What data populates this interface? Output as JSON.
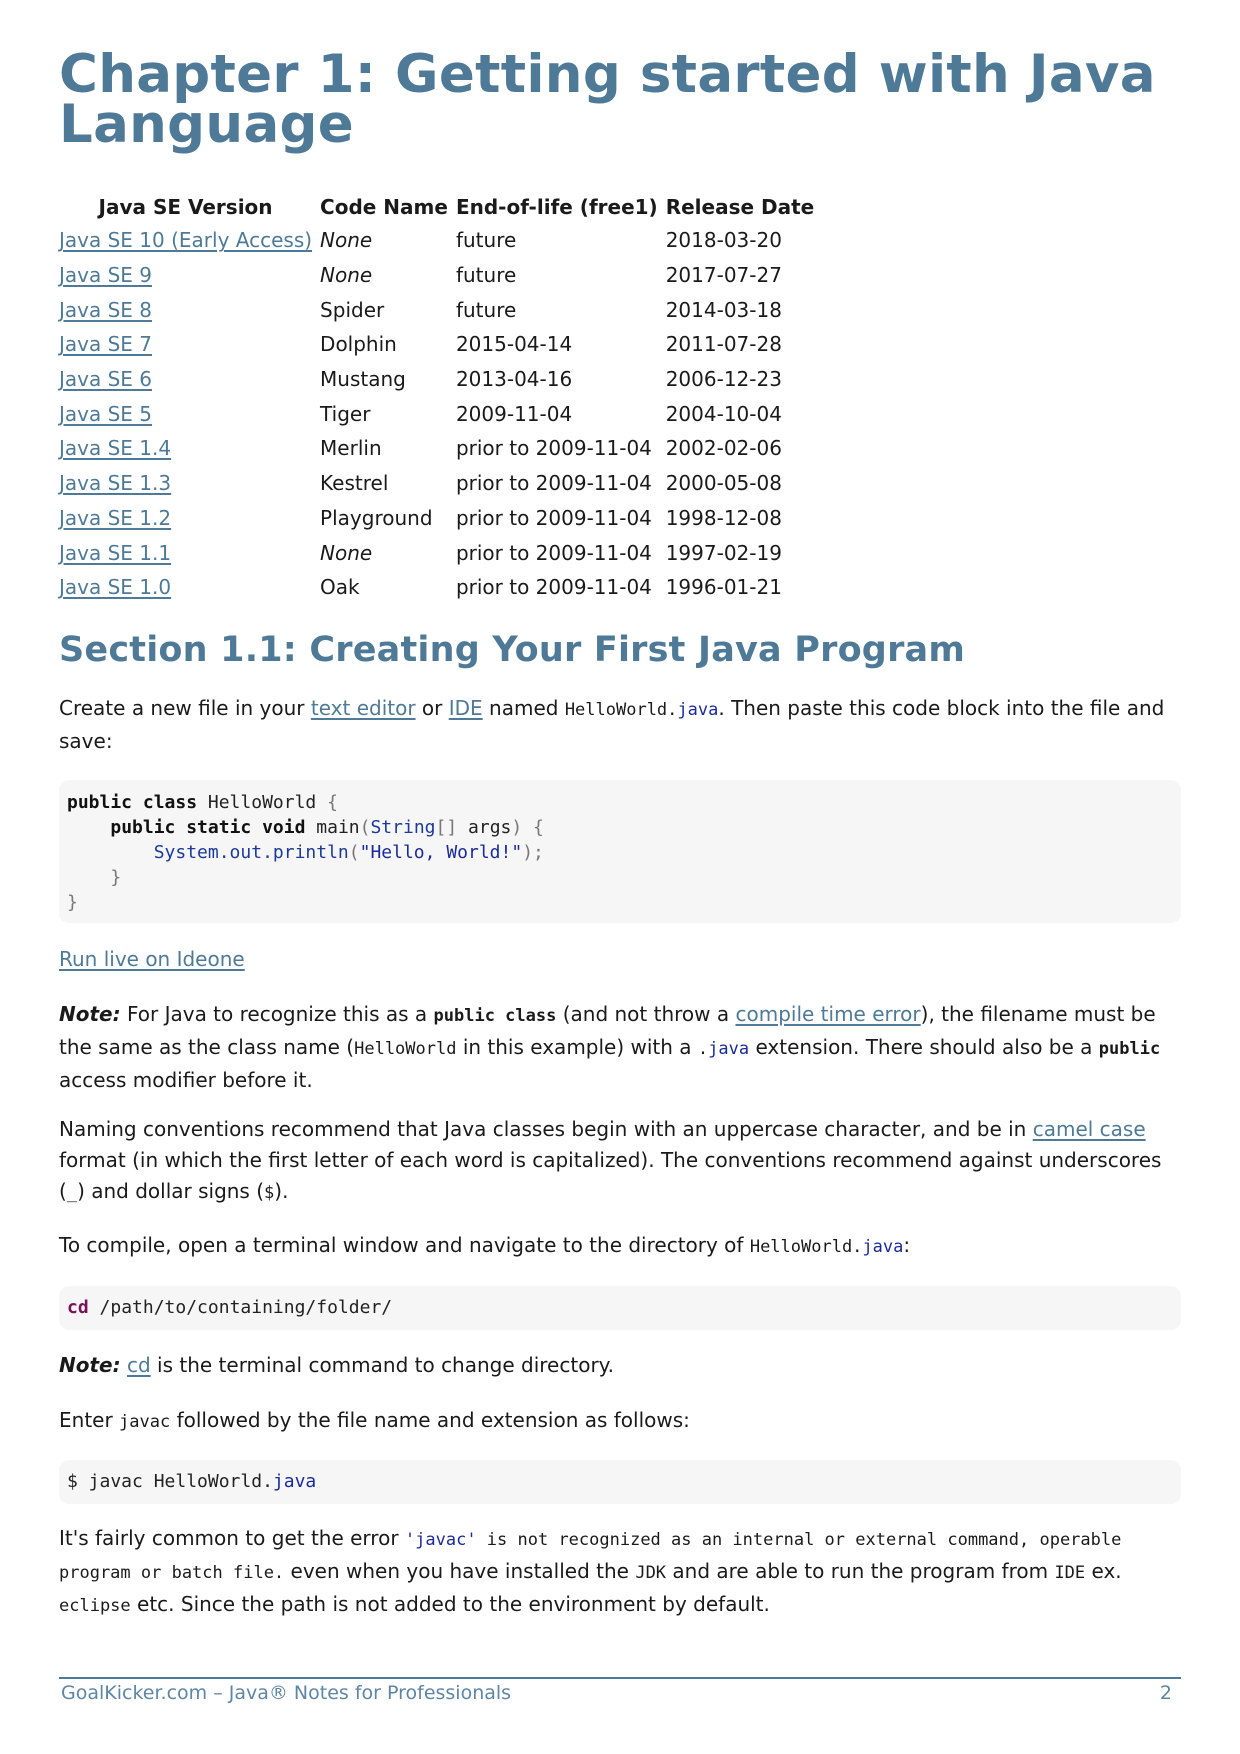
{
  "chapter": {
    "title": "Chapter 1: Getting started with Java Language"
  },
  "versions_table": {
    "headers": [
      "Java SE Version",
      "Code Name",
      "End-of-life (free1)",
      "Release Date"
    ],
    "rows": [
      {
        "version": "Java SE 10 (Early Access)",
        "code_name": "None",
        "code_name_italic": true,
        "eol": "future",
        "release": "2018-03-20"
      },
      {
        "version": "Java SE 9",
        "code_name": "None",
        "code_name_italic": true,
        "eol": "future",
        "release": "2017-07-27"
      },
      {
        "version": "Java SE 8",
        "code_name": "Spider",
        "code_name_italic": false,
        "eol": "future",
        "release": "2014-03-18"
      },
      {
        "version": "Java SE 7",
        "code_name": "Dolphin",
        "code_name_italic": false,
        "eol": "2015-04-14",
        "release": "2011-07-28"
      },
      {
        "version": "Java SE 6",
        "code_name": "Mustang",
        "code_name_italic": false,
        "eol": "2013-04-16",
        "release": "2006-12-23"
      },
      {
        "version": "Java SE 5",
        "code_name": "Tiger",
        "code_name_italic": false,
        "eol": "2009-11-04",
        "release": "2004-10-04"
      },
      {
        "version": "Java SE 1.4",
        "code_name": "Merlin",
        "code_name_italic": false,
        "eol": "prior to 2009-11-04",
        "release": "2002-02-06"
      },
      {
        "version": "Java SE 1.3",
        "code_name": "Kestrel",
        "code_name_italic": false,
        "eol": "prior to 2009-11-04",
        "release": "2000-05-08"
      },
      {
        "version": "Java SE 1.2",
        "code_name": "Playground",
        "code_name_italic": false,
        "eol": "prior to 2009-11-04",
        "release": "1998-12-08"
      },
      {
        "version": "Java SE 1.1",
        "code_name": "None",
        "code_name_italic": true,
        "eol": "prior to 2009-11-04",
        "release": "1997-02-19"
      },
      {
        "version": "Java SE 1.0",
        "code_name": "Oak",
        "code_name_italic": false,
        "eol": "prior to 2009-11-04",
        "release": "1996-01-21"
      }
    ]
  },
  "section": {
    "title": "Section 1.1: Creating Your First Java Program"
  },
  "p1": {
    "t1": "Create a new file in your ",
    "link_text_editor": "text editor",
    "t2": " or ",
    "link_ide": "IDE",
    "t3": " named ",
    "code_file_a": "HelloWorld.",
    "code_file_b": "java",
    "t4": ". Then paste this code block into the file and save:"
  },
  "code_hello": {
    "l1_kw": "public class",
    "l1_rest": " HelloWorld ",
    "l1_brace": "{",
    "l2_indent": "    ",
    "l2_kw": "public static void",
    "l2_name": " main",
    "l2_p1": "(",
    "l2_type": "String",
    "l2_br": "[]",
    "l2_args": " args",
    "l2_p2": ") {",
    "l3_indent": "        ",
    "l3_call": "System.out.println",
    "l3_p1": "(",
    "l3_str": "\"Hello, World!\"",
    "l3_p2": ");",
    "l4": "    }",
    "l5": "}"
  },
  "run_live": "Run live on Ideone",
  "note1": {
    "label": "Note:",
    "t1": " For Java to recognize this as a ",
    "code_public_class": "public class",
    "t2": " (and not throw a ",
    "link_compile_error": "compile time error",
    "t3": "), the filename must be the same as the class name (",
    "code_helloworld": "HelloWorld",
    "t4": " in this example) with a ",
    "code_dot": ".",
    "code_java": "java",
    "t5": " extension. There should also be a ",
    "code_public": "public",
    "t6": " access modifier before it."
  },
  "naming": {
    "t1": "Naming conventions recommend that Java classes begin with an uppercase character, and be in ",
    "link_camel": "camel case",
    "t2": " format (in which the first letter of each word is capitalized). The conventions recommend against underscores (",
    "code_underscore": "_",
    "t3": ") and dollar signs (",
    "code_dollar": "$",
    "t4": ")."
  },
  "compile": {
    "t1": "To compile, open a terminal window and navigate to the directory of ",
    "code_file_a": "HelloWorld.",
    "code_file_b": "java",
    "t2": ":"
  },
  "code_cd": {
    "cmd": "cd",
    "path": " /path/to/containing/folder/"
  },
  "note2": {
    "label": "Note:",
    "link_cd": "cd",
    "t1": " is the terminal command to change directory."
  },
  "enter": {
    "t1": "Enter ",
    "code_javac": "javac",
    "t2": " followed by the file name and extension as follows:"
  },
  "code_javac": {
    "a": "$ javac HelloWorld.",
    "b": "java"
  },
  "error_para": {
    "t1": "It's fairly common to get the error ",
    "code_q1": "'javac'",
    "code_err": " is not recognized as an internal or external command, operable program or batch file.",
    "t2": " even when you have installed the ",
    "code_jdk": "JDK",
    "t3": " and are able to run the program from ",
    "code_ide": "IDE",
    "t4": " ex. ",
    "code_eclipse": "eclipse",
    "t5": " etc. Since the path is not added to the environment by default."
  },
  "footer": {
    "left": "GoalKicker.com – Java® Notes for Professionals",
    "page": "2"
  }
}
